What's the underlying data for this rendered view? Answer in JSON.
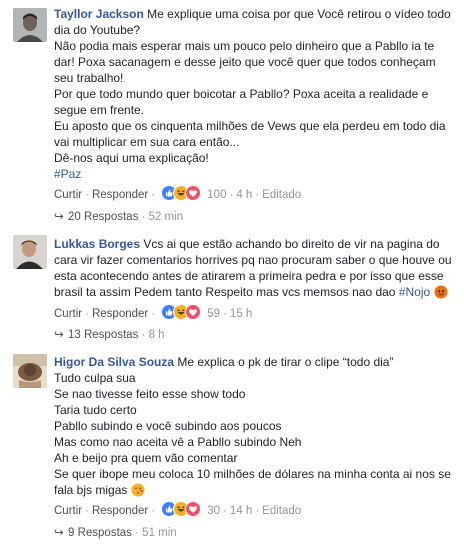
{
  "comments": [
    {
      "name": "Tayllor Jackson",
      "lines": [
        "Me explique uma coisa por que Você retirou o vídeo todo",
        "dia do Youtube?",
        "Não podia mais esperar mais um pouco pelo dinheiro que a Pabllo ia te",
        "dar! Poxa sacanagem e desse jeito que você quer que todos conheçam",
        "seu trabalho!",
        "Por que todo mundo quer boicotar a Pabllo? Poxa aceita a realidade e",
        "segue em frente.",
        "Eu aposto que os cinquenta milhões de Vews que ela perdeu em todo dia",
        "vai multiplicar em sua cara então...",
        "Dê-nos aqui uma explicação!"
      ],
      "hashtag": "#Paz",
      "actions": {
        "like": "Curtir",
        "reply": "Responder",
        "count": "100",
        "time": "4 h",
        "edited": "Editado"
      },
      "replies": {
        "label": "20 Respostas",
        "time": "52 min"
      }
    },
    {
      "name": "Lukkas Borges",
      "lines": [
        "Vcs ai que estão achando bo direito de vir na pagina do",
        "cara vir fazer comentarios horrives pq nao procuram saber o que houve ou",
        "esta acontecendo antes de atirarem a primeira pedra e por isso que esse",
        "brasil ta assim Pedem tanto Respeito mas vcs memsos nao dao"
      ],
      "hashtag": "#Nojo",
      "actions": {
        "like": "Curtir",
        "reply": "Responder",
        "count": "59",
        "time": "15 h"
      },
      "replies": {
        "label": "13 Respostas",
        "time": "8 h"
      }
    },
    {
      "name": "Higor Da Silva Souza",
      "lines": [
        "Me explica o pk de tirar o clipe “todo dia”",
        "Tudo culpa sua",
        "Se nao tivesse feito esse show todo",
        "Taria tudo certo",
        "Pabllo subindo e você subindo aos poucos",
        "Mas como nao aceita vê a Pabllo subindo Neh",
        "Ah e beijo pra quem vão comentar",
        "Se quer ibope meu coloca 10 milhões de dólares na minha conta ai nos se",
        "fala bjs migas"
      ],
      "actions": {
        "like": "Curtir",
        "reply": "Responder",
        "count": "30",
        "time": "14 h",
        "edited": "Editado"
      },
      "replies": {
        "label": "9 Respostas",
        "time": "51 min"
      }
    }
  ],
  "colors": {
    "name": "#365899",
    "meta": "#90949c",
    "link": "#4b4f56"
  },
  "icons": [
    "like-icon",
    "haha-icon",
    "love-icon",
    "angry-icon",
    "kissing-heart-icon",
    "reply-arrow-icon"
  ]
}
